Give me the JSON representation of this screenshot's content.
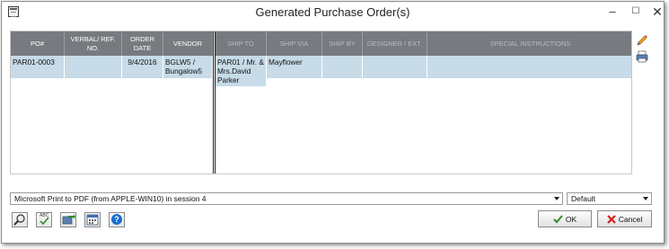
{
  "window": {
    "title": "Generated Purchase Order(s)",
    "minimize": "–",
    "maximize": "☐",
    "close": "✕"
  },
  "grid": {
    "columns": [
      "PO#",
      "VERBAL/ REF. NO.",
      "ORDER DATE",
      "VENDOR",
      "SHIP TO",
      "SHIP VIA",
      "SHIP BY",
      "DESIGNER / EXT.",
      "SPECIAL INSTRUCTIONS"
    ],
    "rows": [
      [
        "PAR01-0003",
        "",
        "9/4/2016",
        "BGLW5 / Bungalow5",
        "PAR01 / Mr. & Mrs.David Parker",
        "Mayflower",
        "",
        "",
        ""
      ]
    ]
  },
  "side_icons": [
    "edit-pencil-icon",
    "print-icon"
  ],
  "printer_select": {
    "value": "Microsoft Print to PDF (from APPLE-WIN10) in session 4"
  },
  "format_select": {
    "value": "Default"
  },
  "toolbar": {
    "buttons": [
      "preview-icon",
      "spellcheck-icon",
      "export-icon",
      "calendar-icon",
      "help-icon"
    ],
    "spellcheck_text": "ABC",
    "help_text": "?",
    "ok_label": "OK",
    "cancel_label": "Cancel"
  },
  "colors": {
    "header_bg": "#777b80",
    "selected_row": "#c7dbe8",
    "ok_check": "#2e8b2e",
    "cancel_x": "#d22020",
    "help_blue": "#1a6fc9"
  }
}
